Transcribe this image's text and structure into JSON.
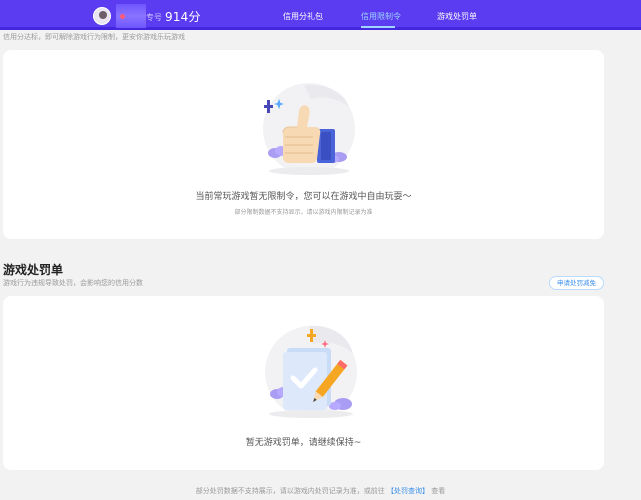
{
  "header": {
    "nickname_suffix": "专号",
    "score": "914分",
    "nav": [
      {
        "label": "信用分礼包"
      },
      {
        "label": "信用限制令"
      },
      {
        "label": "游戏处罚单"
      }
    ],
    "active_tab_index": 1,
    "colors": {
      "bar": "#5b3cf0",
      "active": "#9fd4ff"
    }
  },
  "restriction": {
    "note": "信用分达标，即可解除游戏行为限制，更安你游戏乐玩游戏",
    "message": "当前常玩游戏暂无限制令，您可以在游戏中自由玩耍～",
    "submessage": "部分限制数据不支持显示，请以游戏内限制记录为准",
    "illustration_icon": "thumbs-up-icon"
  },
  "penalty": {
    "title": "游戏处罚单",
    "subtitle": "游戏行为违规导致处罚，会影响您的信用分数",
    "appeal_button": "申请处罚减免",
    "message": "暂无游戏罚单，请继续保持~",
    "illustration_icon": "pencil-document-icon"
  },
  "footer": {
    "text": "部分处罚数据不支持展示，请以游戏内处罚记录为准，或前往",
    "link": "【处罚查询】",
    "suffix": "查看"
  }
}
